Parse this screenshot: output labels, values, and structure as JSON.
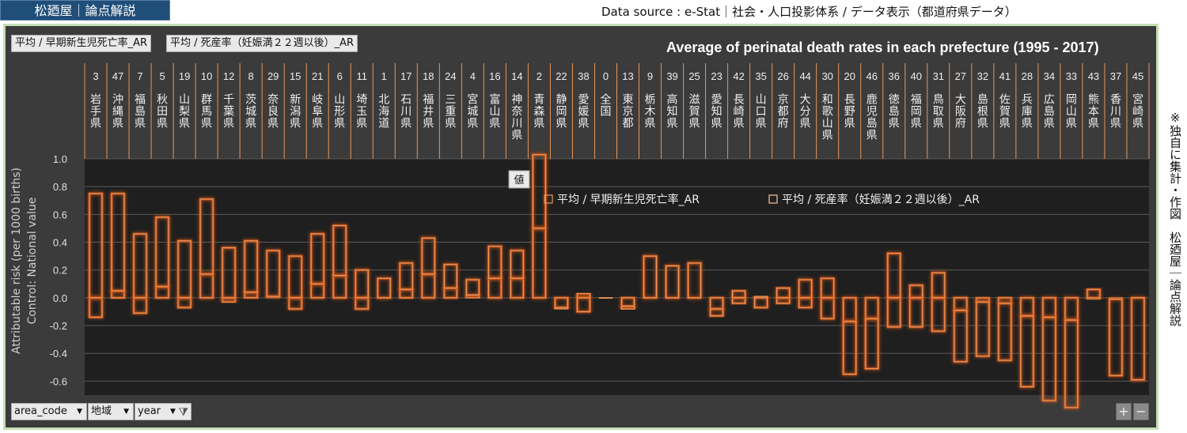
{
  "header": {
    "brand": "松廼屋｜論点解説",
    "source": "Data source : e-Stat｜社会・人口投影体系 / データ表示（都道府県データ）"
  },
  "side_note": "※独自に集計・作図　松廼屋｜論点解説",
  "field_buttons": [
    "平均 / 早期新生児死亡率_AR",
    "平均 / 死産率（妊娠満２２週以後）_AR"
  ],
  "axis_buttons": [
    "area_code",
    "地域",
    "year"
  ],
  "tooltip": "値",
  "zoom": {
    "plus": "+",
    "minus": "−"
  },
  "colors": {
    "background": "#1f1f1f",
    "frame": "#3b3b3b",
    "bar_outline": "#e8965a",
    "glow": "#c8541a",
    "grid": "#5a5a5a"
  },
  "chart_data": {
    "type": "bar",
    "title": "Average of perinatal death rates in each prefecture (1995 - 2017)",
    "ylabel": "Attributable risk (per 1000 births)",
    "ylabel2": "Control: National value",
    "ylim": [
      -0.7,
      1.0
    ],
    "yticks": [
      "1.0",
      "0.8",
      "0.6",
      "0.4",
      "0.2",
      "0.0",
      "-0.2",
      "-0.4",
      "-0.6"
    ],
    "yticks_values": [
      1.0,
      0.8,
      0.6,
      0.4,
      0.2,
      0.0,
      -0.2,
      -0.4,
      -0.6
    ],
    "codes": [
      "3",
      "47",
      "7",
      "5",
      "19",
      "10",
      "12",
      "8",
      "29",
      "15",
      "21",
      "6",
      "11",
      "1",
      "17",
      "18",
      "24",
      "4",
      "16",
      "14",
      "2",
      "22",
      "38",
      "0",
      "13",
      "9",
      "39",
      "25",
      "23",
      "42",
      "35",
      "26",
      "44",
      "30",
      "20",
      "46",
      "36",
      "40",
      "31",
      "27",
      "32",
      "41",
      "28",
      "34",
      "33",
      "43",
      "37",
      "45"
    ],
    "categories": [
      "岩手県",
      "沖縄県",
      "福島県",
      "秋田県",
      "山梨県",
      "群馬県",
      "千葉県",
      "茨城県",
      "奈良県",
      "新潟県",
      "岐阜県",
      "山形県",
      "埼玉県",
      "北海道",
      "石川県",
      "福井県",
      "三重県",
      "宮城県",
      "富山県",
      "神奈川県",
      "青森県",
      "静岡県",
      "愛媛県",
      "全国",
      "東京都",
      "栃木県",
      "高知県",
      "滋賀県",
      "愛知県",
      "長崎県",
      "山口県",
      "京都府",
      "大分県",
      "和歌山県",
      "長野県",
      "鹿児島県",
      "徳島県",
      "福岡県",
      "鳥取県",
      "大阪府",
      "島根県",
      "佐賀県",
      "兵庫県",
      "広島県",
      "岡山県",
      "熊本県",
      "香川県",
      "宮崎県"
    ],
    "series": [
      {
        "name": "平均 / 早期新生児死亡率_AR",
        "values": [
          -0.14,
          0.05,
          -0.11,
          0.08,
          -0.07,
          0.17,
          -0.03,
          0.04,
          0.01,
          -0.08,
          0.1,
          0.16,
          -0.08,
          0.0,
          0.06,
          0.17,
          0.07,
          0.02,
          0.14,
          0.14,
          0.5,
          -0.07,
          -0.1,
          0.0,
          -0.06,
          0.0,
          0.0,
          0.0,
          -0.08,
          -0.04,
          -0.07,
          -0.04,
          -0.07,
          -0.15,
          -0.17,
          -0.15,
          -0.21,
          -0.21,
          -0.24,
          -0.09,
          -0.03,
          -0.04,
          -0.13,
          -0.14,
          -0.16,
          -0.01,
          -0.01,
          0.0
        ]
      },
      {
        "name": "平均 / 死産率（妊娠満２２週以後）_AR",
        "values": [
          0.75,
          0.7,
          0.46,
          0.5,
          0.41,
          0.54,
          0.36,
          0.37,
          0.33,
          0.3,
          0.36,
          0.36,
          0.2,
          0.14,
          0.19,
          0.26,
          0.17,
          0.11,
          0.23,
          0.2,
          0.53,
          -0.01,
          0.03,
          0.0,
          -0.02,
          0.3,
          0.23,
          0.25,
          -0.05,
          0.05,
          0.01,
          0.07,
          0.13,
          0.14,
          -0.38,
          -0.36,
          0.32,
          0.09,
          0.18,
          -0.37,
          -0.39,
          -0.41,
          -0.51,
          -0.6,
          -0.63,
          0.06,
          -0.55,
          -0.59
        ]
      }
    ],
    "grid": true,
    "legend_position": "top-right"
  }
}
